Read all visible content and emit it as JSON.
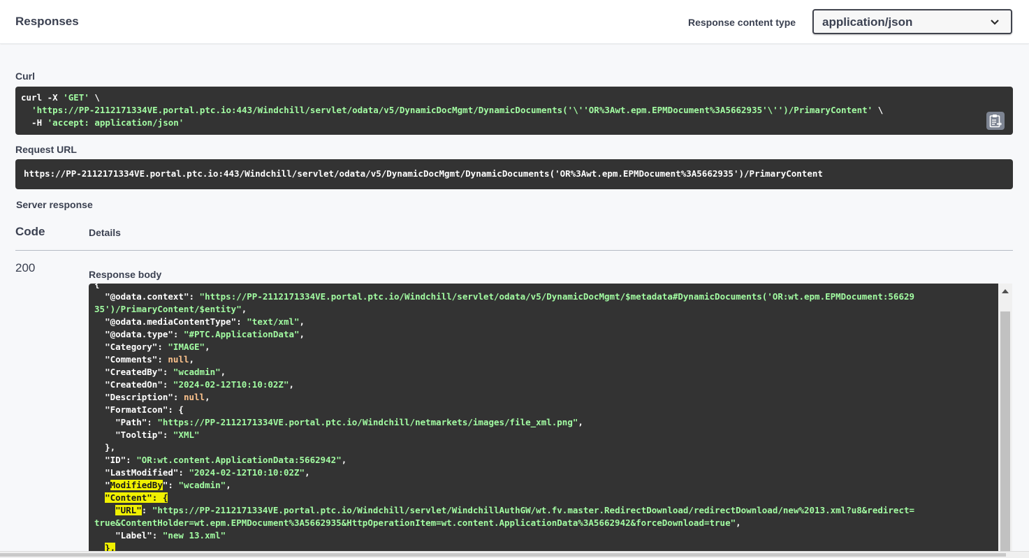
{
  "header": {
    "title": "Responses",
    "content_type_label": "Response content type",
    "content_type_value": "application/json"
  },
  "curl": {
    "label": "Curl",
    "line1": "curl -X ",
    "method": "'GET'",
    "line1_tail": " \\",
    "line2_indent": "  ",
    "url": "'https://PP-2112171334VE.portal.ptc.io:443/Windchill/servlet/odata/v5/DynamicDocMgmt/DynamicDocuments('\\''OR%3Awt.epm.EPMDocument%3A5662935'\\'')/PrimaryContent'",
    "line2_tail": " \\",
    "line3_indent": "  -H ",
    "header": "'accept: application/json'"
  },
  "request_url": {
    "label": "Request URL",
    "value": "https://PP-2112171334VE.portal.ptc.io:443/Windchill/servlet/odata/v5/DynamicDocMgmt/DynamicDocuments('OR%3Awt.epm.EPMDocument%3A5662935')/PrimaryContent"
  },
  "server_response": {
    "label": "Server response",
    "code_header": "Code",
    "details_header": "Details",
    "status_code": "200",
    "response_body_label": "Response body"
  },
  "response_body": {
    "open_brace": "{",
    "odata_context_key": "\"@odata.context\"",
    "odata_context_value_1": "\"https://PP-2112171334VE.portal.ptc.io/Windchill/servlet/odata/v5/DynamicDocMgmt/$metadata#DynamicDocuments('OR:wt.epm.EPMDocument:56629",
    "odata_context_value_2": "35')/PrimaryContent/$entity\"",
    "media_type_key": "\"@odata.mediaContentType\"",
    "media_type_value": "\"text/xml\"",
    "odata_type_key": "\"@odata.type\"",
    "odata_type_value": "\"#PTC.ApplicationData\"",
    "category_key": "\"Category\"",
    "category_value": "\"IMAGE\"",
    "comments_key": "\"Comments\"",
    "null_text": "null",
    "created_by_key": "\"CreatedBy\"",
    "created_by_value": "\"wcadmin\"",
    "created_on_key": "\"CreatedOn\"",
    "created_on_value": "\"2024-02-12T10:10:02Z\"",
    "description_key": "\"Description\"",
    "format_icon_key": "\"FormatIcon\"",
    "path_key": "\"Path\"",
    "path_value": "\"https://PP-2112171334VE.portal.ptc.io/Windchill/netmarkets/images/file_xml.png\"",
    "tooltip_key": "\"Tooltip\"",
    "tooltip_value": "\"XML\"",
    "id_key": "\"ID\"",
    "id_value": "\"OR:wt.content.ApplicationData:5662942\"",
    "last_modified_key": "\"LastModified\"",
    "last_modified_value": "\"2024-02-12T10:10:02Z\"",
    "modified_by_key_open": "\"",
    "modified_by_key_word": "ModifiedBy",
    "modified_by_key_close": "\"",
    "modified_by_value": "\"wcadmin\"",
    "content_key": "\"Content\": {",
    "url_key": "\"URL\"",
    "url_value_1": "\"https://PP-2112171334VE.portal.ptc.io/Windchill/servlet/WindchillAuthGW/wt.fv.master.RedirectDownload/redirectDownload/new%2013.xml?u8&redirect=",
    "url_value_2": "true&ContentHolder=wt.epm.EPMDocument%3A5662935&HttpOperationItem=wt.content.ApplicationData%3A5662942&forceDownload=true\"",
    "label_key": "\"Label\"",
    "label_value": "\"new 13.xml\"",
    "close_brace_comma": "},"
  },
  "colors": {
    "code_bg": "#333333",
    "string": "#a2fca2",
    "null": "#fcc28c",
    "highlight": "#f0f000"
  },
  "icons": {
    "select_chevron": "chevron-down-icon",
    "copy": "clipboard-copy-icon",
    "scroll_up": "scroll-up-arrow-icon"
  }
}
